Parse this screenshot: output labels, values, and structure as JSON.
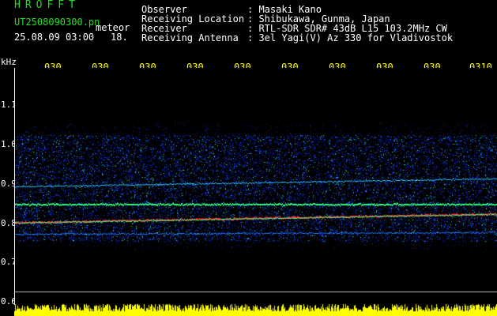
{
  "header": {
    "logo": "HROFFT",
    "filename": "UT2508090300.pn",
    "subtitle_meteor": "meteor",
    "datetime": "25.08.09 03:00",
    "count": "18.",
    "fields": [
      {
        "label": "Observer",
        "value": ": Masaki Kano"
      },
      {
        "label": "Receiving Location",
        "value": ": Shibukawa, Gunma, Japan"
      },
      {
        "label": "Receiver",
        "value": ": RTL-SDR SDR# 43dB L15 103.2MHz CW"
      },
      {
        "label": "Receiving Antenna",
        "value": ": 3el Yagi(V) Az 330 for Vladivostok"
      }
    ]
  },
  "axis": {
    "unit": "kHz",
    "y_labels": [
      "1.1",
      "1.0",
      "0.9",
      "0.8",
      "0.7",
      "0.6"
    ],
    "x_labels": [
      "030",
      "030",
      "030",
      "030",
      "030",
      "030",
      "030",
      "030",
      "030",
      "0310"
    ]
  },
  "colors": {
    "label_green": "#21e021",
    "text_white": "#ffffff",
    "time_yellow": "#ffff00",
    "noise_blue": "#1a3fff",
    "signal_red": "#ff2020",
    "signal_green": "#30ff80",
    "amplitude_yellow": "#ffff00"
  }
}
